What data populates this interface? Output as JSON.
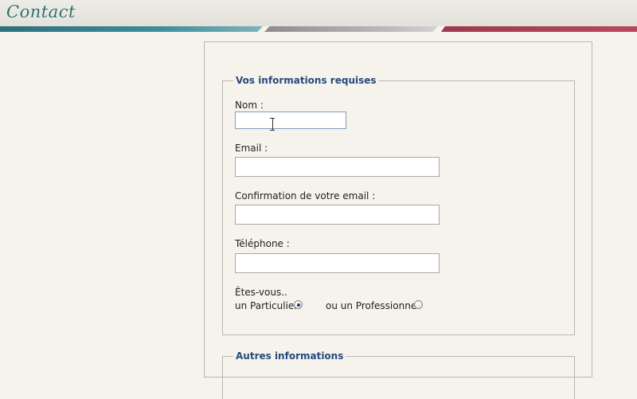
{
  "header": {
    "title": "Contact"
  },
  "form": {
    "required_legend": "Vos informations requises",
    "nom_label": "Nom :",
    "nom_value": "",
    "email_label": "Email :",
    "email_value": "",
    "confirm_label": "Confirmation de votre email :",
    "confirm_value": "",
    "phone_label": "Téléphone :",
    "phone_value": "",
    "type_question": "Êtes-vous..",
    "option_particulier": "un Particulier",
    "option_professionnel": "ou un Professionnel",
    "selected_option": "particulier",
    "other_legend": "Autres informations"
  },
  "colors": {
    "legend": "#264a7e",
    "title": "#2c6e74",
    "stripe_teal": "#3c8d9a",
    "stripe_gray": "#b9b9b9",
    "stripe_red": "#b8485f"
  }
}
